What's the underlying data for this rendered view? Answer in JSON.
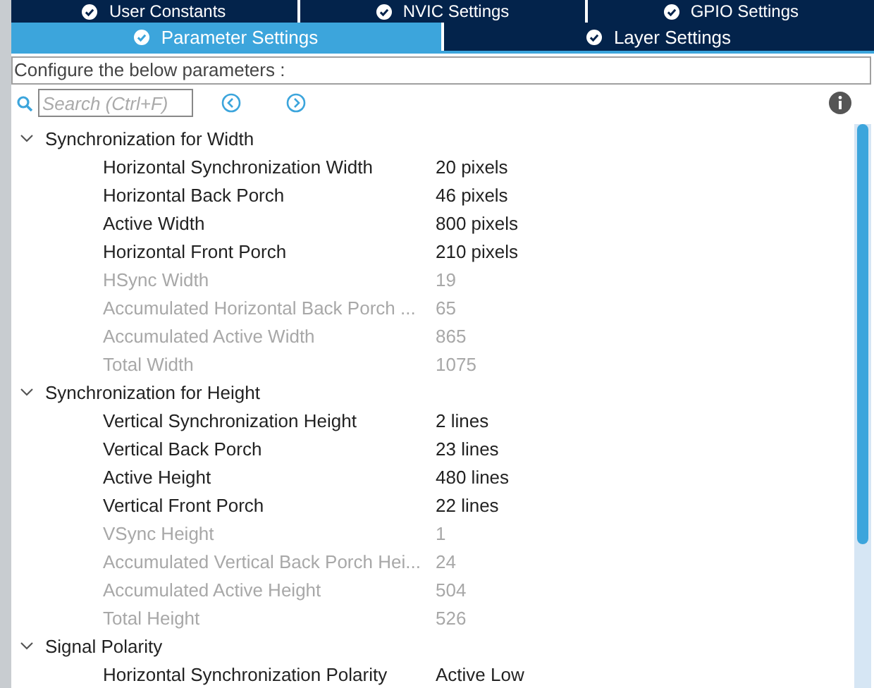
{
  "tab_rows": [
    {
      "tabs": [
        {
          "label": "User Constants",
          "selected": false
        },
        {
          "label": "NVIC Settings",
          "selected": false
        },
        {
          "label": "GPIO Settings",
          "selected": false
        }
      ]
    },
    {
      "tabs": [
        {
          "label": "Parameter Settings",
          "selected": true
        },
        {
          "label": "Layer Settings",
          "selected": false
        }
      ]
    }
  ],
  "description": "Configure the below parameters :",
  "search": {
    "placeholder": "Search (Ctrl+F)"
  },
  "groups": [
    {
      "title": "Synchronization for Width",
      "expanded": true,
      "params": [
        {
          "name": "Horizontal Synchronization Width",
          "value": "20 pixels",
          "disabled": false
        },
        {
          "name": "Horizontal Back Porch",
          "value": "46 pixels",
          "disabled": false
        },
        {
          "name": "Active Width",
          "value": "800 pixels",
          "disabled": false
        },
        {
          "name": "Horizontal Front Porch",
          "value": "210 pixels",
          "disabled": false
        },
        {
          "name": "HSync Width",
          "value": "19",
          "disabled": true
        },
        {
          "name": "Accumulated Horizontal Back Porch ...",
          "value": "65",
          "disabled": true
        },
        {
          "name": "Accumulated Active Width",
          "value": "865",
          "disabled": true
        },
        {
          "name": "Total Width",
          "value": "1075",
          "disabled": true
        }
      ]
    },
    {
      "title": "Synchronization for Height",
      "expanded": true,
      "params": [
        {
          "name": "Vertical Synchronization Height",
          "value": "2 lines",
          "disabled": false
        },
        {
          "name": "Vertical Back Porch",
          "value": "23 lines",
          "disabled": false
        },
        {
          "name": "Active Height",
          "value": "480 lines",
          "disabled": false
        },
        {
          "name": "Vertical Front Porch",
          "value": "22 lines",
          "disabled": false
        },
        {
          "name": "VSync Height",
          "value": "1",
          "disabled": true
        },
        {
          "name": "Accumulated Vertical Back Porch Hei...",
          "value": "24",
          "disabled": true
        },
        {
          "name": "Accumulated Active Height",
          "value": "504",
          "disabled": true
        },
        {
          "name": "Total Height",
          "value": "526",
          "disabled": true
        }
      ]
    },
    {
      "title": "Signal Polarity",
      "expanded": true,
      "params": [
        {
          "name": "Horizontal Synchronization Polarity",
          "value": "Active Low",
          "disabled": false
        }
      ]
    }
  ]
}
